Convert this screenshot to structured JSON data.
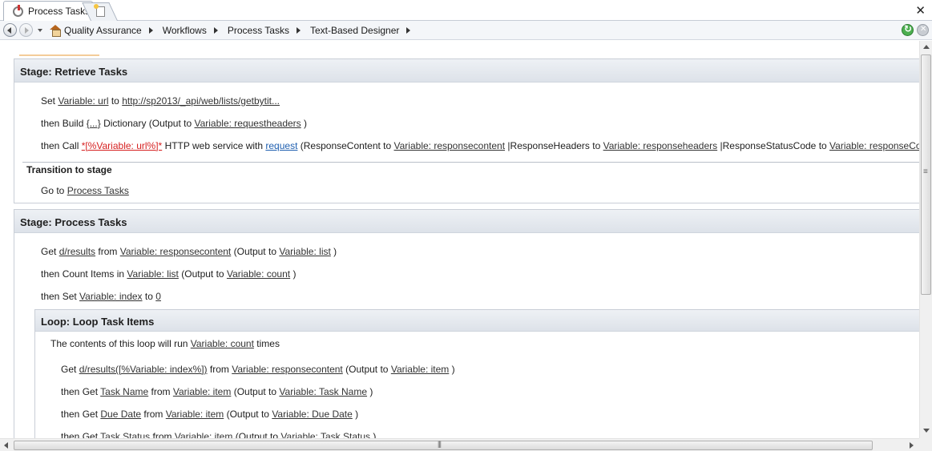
{
  "tab": {
    "title": "Process Tasks"
  },
  "breadcrumbs": [
    "Quality Assurance",
    "Workflows",
    "Process Tasks",
    "Text-Based Designer"
  ],
  "stage1": {
    "title": "Stage: Retrieve Tasks",
    "line1": {
      "w1": "Set",
      "var": "Variable: url",
      "w2": "to",
      "url": "http://sp2013/_api/web/lists/getbytit..."
    },
    "line2": {
      "w1": "then Build",
      "dict": "{...}",
      "w2": "Dictionary (Output to",
      "var": "Variable: requestheaders",
      "w3": ")"
    },
    "line3": {
      "w1": "then Call",
      "call": "*[%Variable: url%]*",
      "w2": "HTTP web service with",
      "req": "request",
      "w3": "(ResponseContent to",
      "v1": "Variable: responsecontent",
      "w4": "|ResponseHeaders to",
      "v2": "Variable: responseheaders",
      "w5": "|ResponseStatusCode to",
      "v3": "Variable: responseCode",
      "w6": ")"
    },
    "transition_title": "Transition to stage",
    "goto": {
      "w1": "Go to",
      "target": "Process Tasks"
    }
  },
  "stage2": {
    "title": "Stage: Process Tasks",
    "line1": {
      "w1": "Get",
      "path": "d/results",
      "w2": "from",
      "var": "Variable: responsecontent",
      "w3": "(Output to",
      "out": "Variable: list",
      "w4": ")"
    },
    "line2": {
      "w1": "then Count Items in",
      "var": "Variable: list",
      "w2": "(Output to",
      "out": "Variable: count",
      "w3": ")"
    },
    "line3": {
      "w1": "then Set",
      "var": "Variable: index",
      "w2": "to",
      "val": "0"
    },
    "loop": {
      "title": "Loop: Loop Task Items",
      "desc": {
        "w1": "The contents of this loop will run",
        "var": "Variable: count",
        "w2": "times"
      },
      "line1": {
        "w1": "Get",
        "path": "d/results([%Variable: index%])",
        "w2": "from",
        "var": "Variable: responsecontent",
        "w3": "(Output to",
        "out": "Variable: item",
        "w4": ")"
      },
      "line2": {
        "w1": "then Get",
        "field": "Task Name",
        "w2": "from",
        "var": "Variable: item",
        "w3": "(Output to",
        "out": "Variable: Task Name",
        "w4": ")"
      },
      "line3": {
        "w1": "then Get",
        "field": "Due Date",
        "w2": "from",
        "var": "Variable: item",
        "w3": "(Output to",
        "out": "Variable: Due Date",
        "w4": ")"
      },
      "line4": {
        "w1": "then Get",
        "field": "Task Status",
        "w2": "from",
        "var": "Variable: item",
        "w3": "(Output to",
        "out": "Variable: Task Status",
        "w4": ")"
      }
    }
  }
}
